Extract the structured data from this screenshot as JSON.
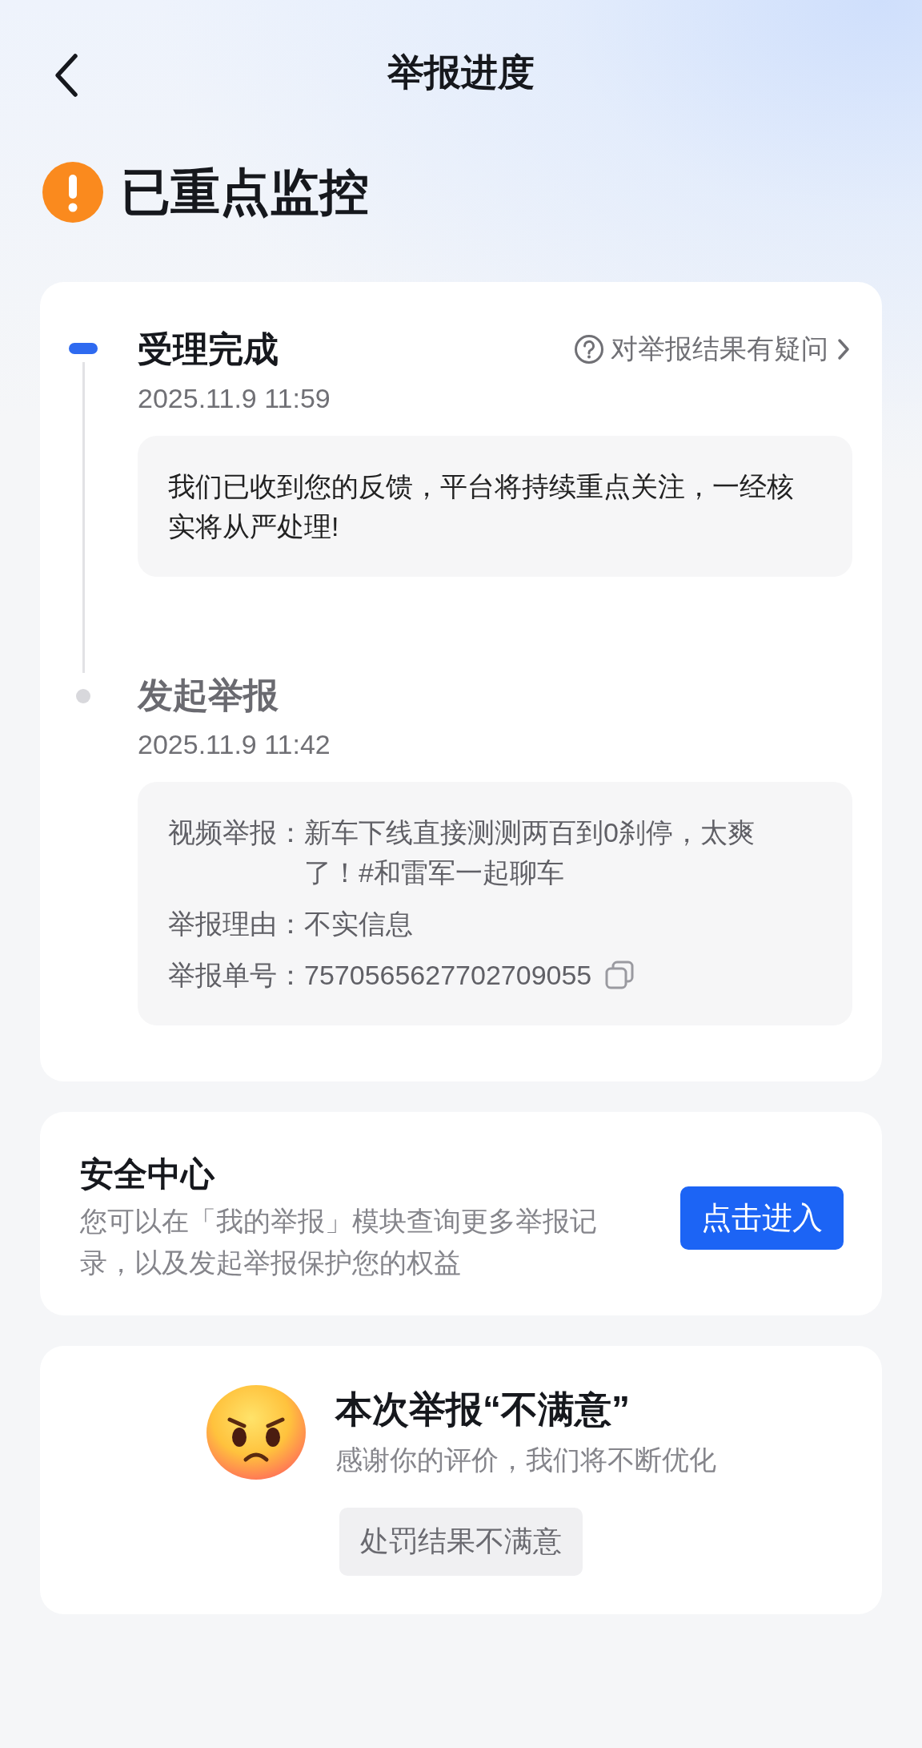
{
  "header": {
    "title": "举报进度"
  },
  "status": {
    "title": "已重点监控"
  },
  "timeline": {
    "query_link": "对举报结果有疑问",
    "steps": [
      {
        "title": "受理完成",
        "time": "2025.11.9 11:59",
        "active": true,
        "kind": "message",
        "message": "我们已收到您的反馈，平台将持续重点关注，一经核实将从严处理!"
      },
      {
        "title": "发起举报",
        "time": "2025.11.9 11:42",
        "active": false,
        "kind": "details",
        "details": [
          {
            "label": "视频举报：",
            "value": "新车下线直接测测两百到0刹停，太爽了！#和雷军一起聊车",
            "copyable": false
          },
          {
            "label": "举报理由：",
            "value": "不实信息",
            "copyable": false
          },
          {
            "label": "举报单号：",
            "value": "7570565627702709055",
            "copyable": true
          }
        ]
      }
    ]
  },
  "safety_center": {
    "title": "安全中心",
    "description": "您可以在「我的举报」模块查询更多举报记录，以及发起举报保护您的权益",
    "button": "点击进入"
  },
  "rating": {
    "title": "本次举报“不满意”",
    "subtitle": "感谢你的评价，我们将不断优化",
    "button": "处罚结果不满意"
  }
}
